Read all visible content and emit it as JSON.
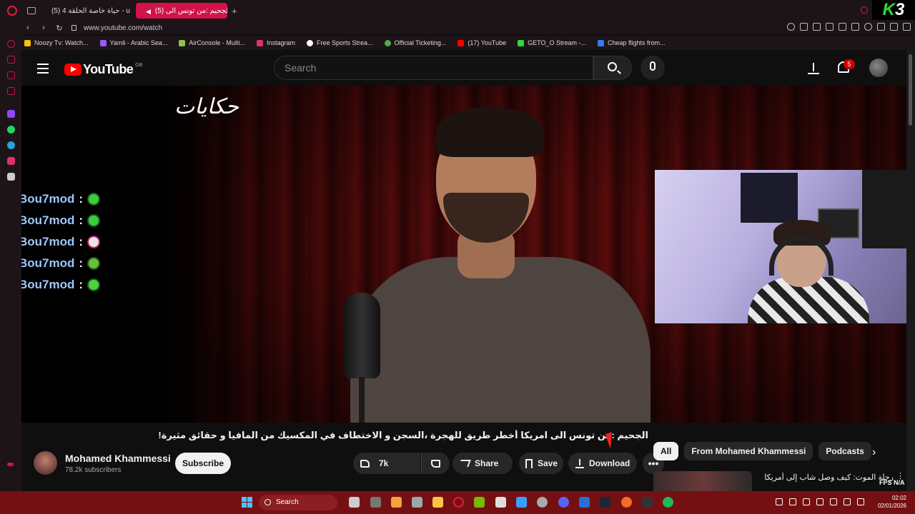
{
  "browser": {
    "tabs": [
      {
        "label": "(5) حياة خاصة الحلقة 4 - ube",
        "active": false
      },
      {
        "label": "(5) الجحيم :من تونس الى",
        "active": true
      }
    ],
    "url": "www.youtube.com/watch",
    "bookmarks": [
      {
        "label": "Noozy Tv: Watch...",
        "color": "#f7c600"
      },
      {
        "label": "Yamli - Arabic Sea...",
        "color": "#9b59ff"
      },
      {
        "label": "AirConsole - Multi...",
        "color": "#8bc34a"
      },
      {
        "label": "Instagram",
        "color": "#e1306c"
      },
      {
        "label": "Free Sports Strea...",
        "color": "#ffffff"
      },
      {
        "label": "Official Ticketing...",
        "color": "#4caf50"
      },
      {
        "label": "(17) YouTube",
        "color": "#ff0000"
      },
      {
        "label": "GETO_O Stream -...",
        "color": "#2bdc3a"
      },
      {
        "label": "Cheap flights from...",
        "color": "#2f7df6"
      }
    ],
    "overlay_logo": {
      "k": "K",
      "three": "3"
    }
  },
  "youtube": {
    "logo_text": "YouTube",
    "country_code": "GB",
    "search_placeholder": "Search",
    "notification_count": "5",
    "video": {
      "show_logo": "حكايات",
      "title": "الجحيم :من تونس الى امريكا أخطر طريق للهجرة ،السجن و الاختطاف في المكسيك من المافيا و حقائق مثيرة!",
      "channel_name": "Mohamed Khammessi",
      "subscribers": "78.2k subscribers",
      "subscribe_label": "Subscribe",
      "like_count": "7k",
      "share_label": "Share",
      "save_label": "Save",
      "download_label": "Download",
      "more_label": "•••"
    },
    "chat": [
      {
        "user": "Bou7mod",
        "sep": ":",
        "emote": "green-face-emote"
      },
      {
        "user": "Bou7mod",
        "sep": ":",
        "emote": "green-face-emote"
      },
      {
        "user": "Bou7mod",
        "sep": ":",
        "emote": "goggles-emote"
      },
      {
        "user": "Bou7mod",
        "sep": ":",
        "emote": "sick-emote"
      },
      {
        "user": "Bou7mod",
        "sep": ":",
        "emote": "grin-emote"
      }
    ],
    "chips": [
      "All",
      "From Mohamed Khammessi",
      "Podcasts"
    ],
    "recommendation": {
      "title": "رحلة الموت: كيف وصل شاب إلى أمريكا"
    },
    "stats_overlay": "FPS N/A"
  },
  "taskbar": {
    "search_label": "Search",
    "time": "02:02",
    "date": "02/01/2026"
  }
}
